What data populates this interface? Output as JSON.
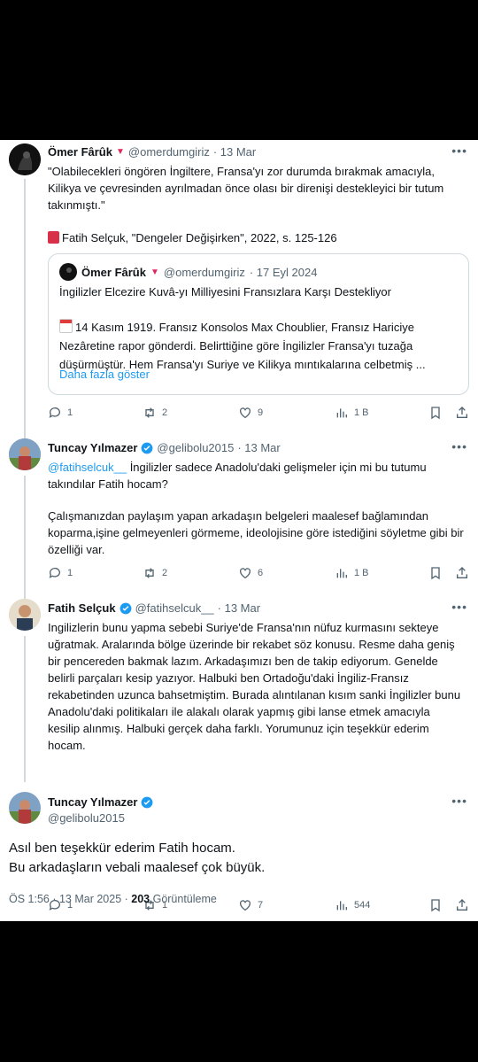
{
  "tweets": [
    {
      "name": "Ömer Fârûk",
      "badge": "▼",
      "handle": "@omerdumgiriz",
      "time": "· 13 Mar",
      "text": "\"Olabilecekleri öngören İngiltere, Fransa'yı zor durumda bırakmak amacıyla, Kilikya ve çevresinden ayrılmadan önce olası bir direnişi destekleyici bir tutum takınmıştı.\"",
      "source": "Fatih Selçuk, \"Dengeler Değişirken\", 2022, s. 125-126",
      "quote": {
        "name": "Ömer Fârûk",
        "badge": "▼",
        "handle": "@omerdumgiriz",
        "time": "· 17 Eyl 2024",
        "title": "İngilizler Elcezire Kuvâ-yı Milliyesini Fransızlara Karşı Destekliyor",
        "text": "14 Kasım 1919. Fransız Konsolos Max Choublier, Fransız Hariciye Nezâretine rapor gönderdi. Belirttiğine göre İngilizler Fransa'yı tuzağa düşürmüştür. Hem Fransa'yı Suriye ve Kilikya mıntıkalarına celbetmiş ...",
        "show_more": "Daha fazla göster"
      },
      "counts": {
        "reply": "1",
        "retweet": "2",
        "like": "9",
        "views": "1 B"
      }
    },
    {
      "name": "Tuncay Yılmazer",
      "handle": "@gelibolu2015",
      "time": "· 13 Mar",
      "mention": "@fatihselcuk__",
      "text_after_mention": " İngilizler sadece Anadolu'daki gelişmeler için mi bu tutumu takındılar Fatih hocam?",
      "text2": "Çalışmanızdan paylaşım yapan arkadaşın belgeleri maalesef bağlamından koparma,işine gelmeyenleri görmeme, ideolojisine göre istediğini söyletme gibi bir özelliği var.",
      "counts": {
        "reply": "1",
        "retweet": "2",
        "like": "6",
        "views": "1 B"
      }
    },
    {
      "name": "Fatih Selçuk",
      "handle": "@fatihselcuk__",
      "time": "· 13 Mar",
      "text": "Ingilizlerin bunu yapma sebebi Suriye'de Fransa'nın nüfuz kurmasını sekteye uğratmak. Aralarında bölge üzerinde bir rekabet söz konusu. Resme daha geniş bir pencereden bakmak lazım. Arkadaşımızı ben de takip ediyorum. Genelde belirli parçaları kesip yazıyor. Halbuki ben Ortadoğu'daki İngiliz-Fransız rekabetinden uzunca bahsetmiştim. Burada alıntılanan kısım sanki İngilizler bunu Anadolu'daki politikaları ile alakalı olarak yapmış gibi lanse etmek amacıyla kesilip alınmış. Halbuki gerçek daha farklı. Yorumunuz için teşekkür ederim hocam.",
      "counts": {
        "reply": "1",
        "retweet": "1",
        "like": "7",
        "views": "544"
      }
    }
  ],
  "main": {
    "name": "Tuncay Yılmazer",
    "handle": "@gelibolu2015",
    "line1": "Asıl ben teşekkür ederim Fatih hocam.",
    "line2": "Bu arkadaşların vebali maalesef çok büyük.",
    "timestamp": "ÖS 1:56 · 13 Mar 2025 · ",
    "views": "203",
    "views_label": " Görüntüleme"
  },
  "colors": {
    "accent": "#1d9bf0",
    "muted": "#536471",
    "border": "#cfd9de"
  }
}
